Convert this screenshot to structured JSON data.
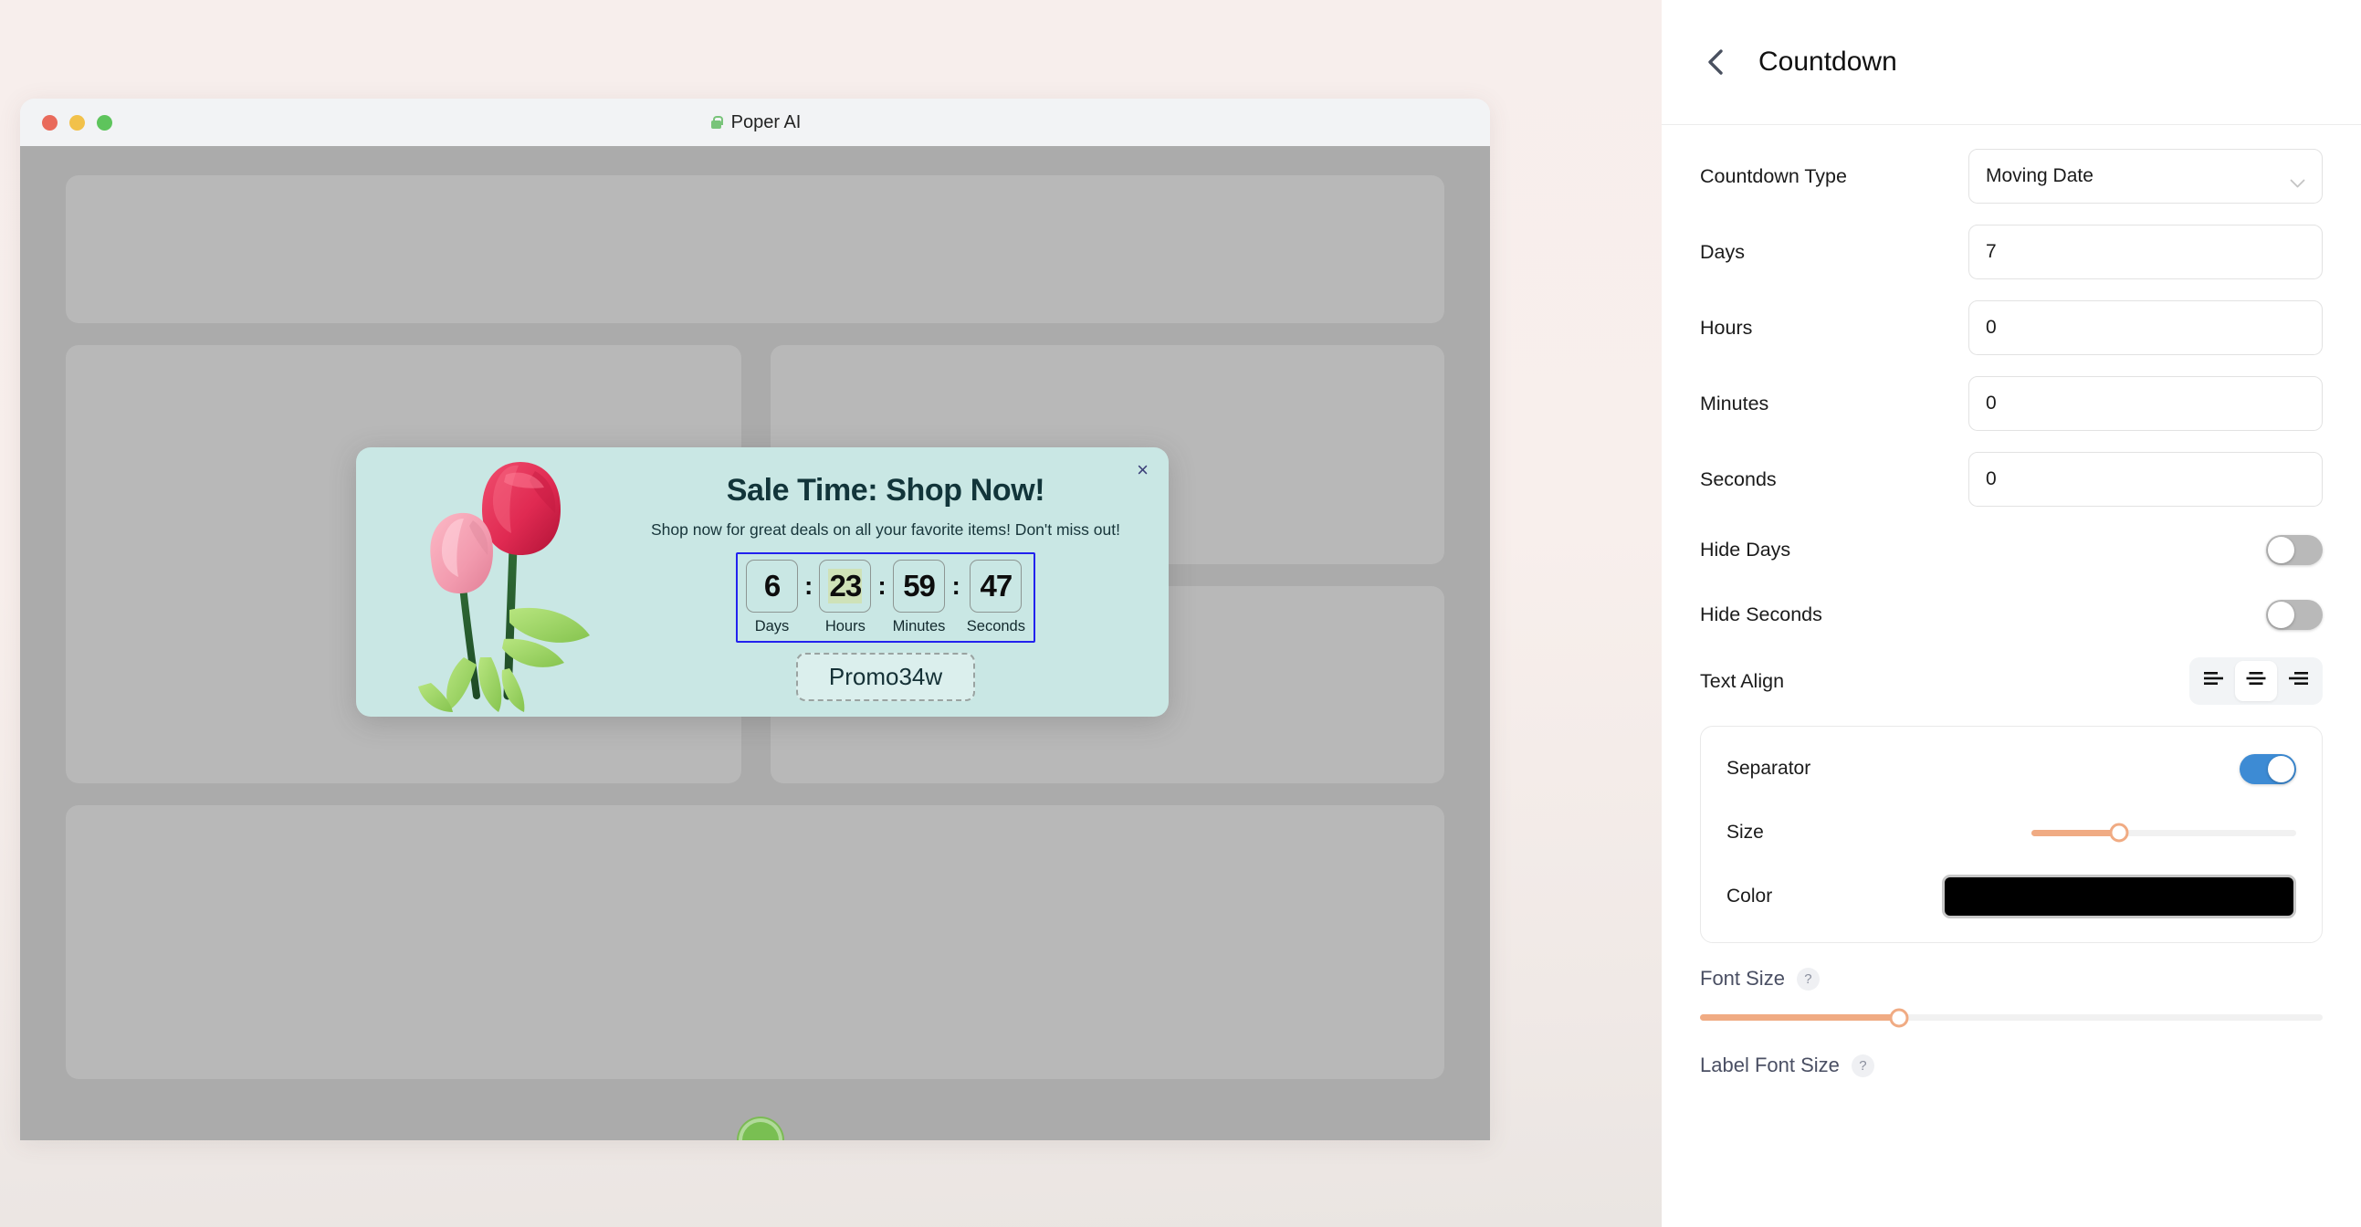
{
  "preview": {
    "window_title": "Poper AI",
    "lock_icon": "lock-icon",
    "traffic_lights": [
      "close-red",
      "minimize-yellow",
      "maximize-green"
    ],
    "popup": {
      "close_label": "×",
      "title": "Sale Time: Shop Now!",
      "subtitle": "Shop now for great deals on all your favorite items! Don't miss out!",
      "countdown": {
        "units": [
          {
            "value": "6",
            "label": "Days",
            "highlighted": false
          },
          {
            "value": "23",
            "label": "Hours",
            "highlighted": true
          },
          {
            "value": "59",
            "label": "Minutes",
            "highlighted": false
          },
          {
            "value": "47",
            "label": "Seconds",
            "highlighted": false
          }
        ],
        "separator": ":"
      },
      "promo_code": "Promo34w",
      "background_color": "#c9e7e4",
      "selection_outline_color": "#2222ee"
    }
  },
  "panel": {
    "header": {
      "back_icon": "chevron-left-icon",
      "title": "Countdown"
    },
    "fields": {
      "countdown_type": {
        "label": "Countdown Type",
        "value": "Moving Date",
        "chevron": "chevron-down-icon"
      },
      "days": {
        "label": "Days",
        "value": "7"
      },
      "hours": {
        "label": "Hours",
        "value": "0"
      },
      "minutes": {
        "label": "Minutes",
        "value": "0"
      },
      "seconds": {
        "label": "Seconds",
        "value": "0"
      }
    },
    "toggles": {
      "hide_days": {
        "label": "Hide Days",
        "on": false
      },
      "hide_seconds": {
        "label": "Hide Seconds",
        "on": false
      }
    },
    "text_align": {
      "label": "Text Align",
      "options": [
        "left",
        "center",
        "right"
      ],
      "selected": "center"
    },
    "separator_card": {
      "separator": {
        "label": "Separator",
        "on": true
      },
      "size": {
        "label": "Size",
        "percent": 33
      },
      "color": {
        "label": "Color",
        "value": "#000000"
      }
    },
    "font_size": {
      "label": "Font Size",
      "help": "?",
      "percent": 32
    },
    "label_font_size": {
      "label": "Label Font Size",
      "help": "?"
    },
    "accent_slider_color": "#f0ab83",
    "accent_toggle_on_color": "#3d8bd4"
  }
}
